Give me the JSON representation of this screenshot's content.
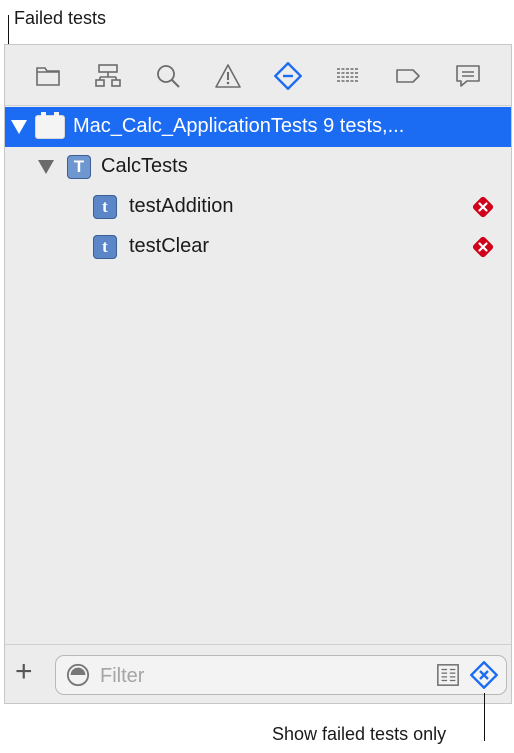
{
  "callouts": {
    "failed_tests": "Failed tests",
    "show_failed_only": "Show failed tests only"
  },
  "toolbar": {
    "icons": [
      "folder-icon",
      "hierarchy-icon",
      "search-icon",
      "warning-icon",
      "test-navigator-icon",
      "debug-icon",
      "breakpoint-icon",
      "report-icon"
    ],
    "active_icon": "test-navigator-icon"
  },
  "tree": {
    "root": {
      "label": "Mac_Calc_ApplicationTests 9 tests,...",
      "selected": true
    },
    "group": {
      "label": "CalcTests",
      "icon_letter": "T"
    },
    "tests": [
      {
        "label": "testAddition",
        "icon_letter": "t",
        "status": "failed"
      },
      {
        "label": "testClear",
        "icon_letter": "t",
        "status": "failed"
      }
    ]
  },
  "filter": {
    "placeholder": "Filter",
    "value": ""
  },
  "colors": {
    "selection": "#1b6cf2",
    "accent": "#1b6cf2",
    "fail": "#d0021b"
  }
}
